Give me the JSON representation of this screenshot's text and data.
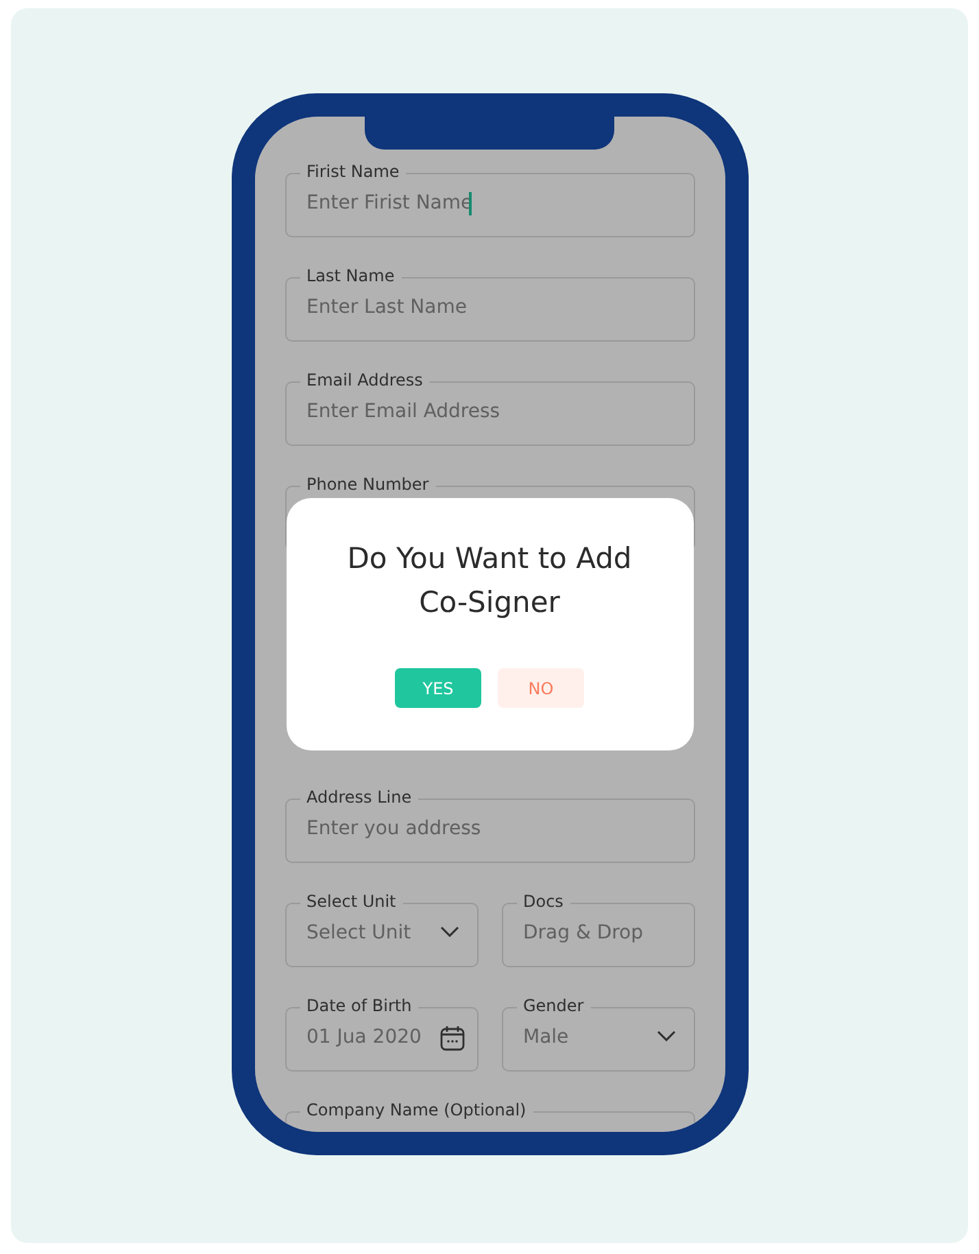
{
  "form": {
    "rows": [
      {
        "fields": [
          {
            "kind": "text",
            "label": "Firist Name",
            "placeholder": "Enter Firist Name",
            "focused": true
          }
        ]
      },
      {
        "fields": [
          {
            "kind": "text",
            "label": "Last Name",
            "placeholder": "Enter Last Name",
            "focused": false
          }
        ]
      },
      {
        "fields": [
          {
            "kind": "text",
            "label": "Email Address",
            "placeholder": "Enter Email Address",
            "focused": false
          }
        ]
      },
      {
        "fields": [
          {
            "kind": "text",
            "label": "Phone Number",
            "focused": false
          }
        ]
      },
      {
        "fields": [
          {
            "kind": "hidden"
          }
        ]
      },
      {
        "fields": [
          {
            "kind": "hidden"
          }
        ]
      },
      {
        "fields": [
          {
            "kind": "text",
            "label": "Address Line",
            "placeholder": "Enter you address",
            "focused": false
          }
        ]
      },
      {
        "fields": [
          {
            "kind": "select",
            "label": "Select Unit",
            "placeholder": "Select Unit",
            "focused": false
          },
          {
            "kind": "upload",
            "label": "Docs",
            "placeholder": "Drag & Drop",
            "focused": false
          }
        ]
      },
      {
        "fields": [
          {
            "kind": "date",
            "label": "Date of Birth",
            "placeholder": "01 Jua 2020",
            "focused": false
          },
          {
            "kind": "select",
            "label": "Gender",
            "placeholder": "Male",
            "focused": false
          }
        ]
      },
      {
        "fields": [
          {
            "kind": "text",
            "label": "Company Name (Optional)",
            "focused": false
          }
        ]
      }
    ]
  },
  "dialog": {
    "title": "Do You Want to Add Co-Signer",
    "buttons": [
      {
        "kind": "primary",
        "label": "YES"
      },
      {
        "kind": "secondary",
        "label": "NO"
      }
    ]
  }
}
